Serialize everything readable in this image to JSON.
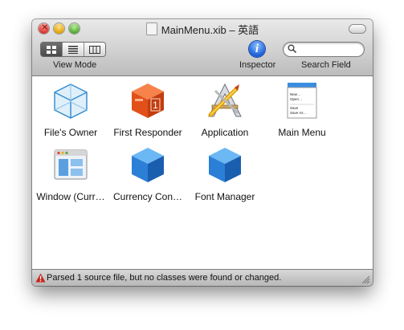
{
  "window": {
    "title": "MainMenu.xib – 英語"
  },
  "toolbar": {
    "view_mode_label": "View Mode",
    "inspector_label": "Inspector",
    "inspector_glyph": "i",
    "search_label": "Search Field",
    "search_value": "",
    "search_placeholder": ""
  },
  "items": [
    {
      "label": "File's Owner",
      "icon": "wireframe-cube-icon"
    },
    {
      "label": "First Responder",
      "icon": "first-responder-cube-icon"
    },
    {
      "label": "Application",
      "icon": "application-icon"
    },
    {
      "label": "Main Menu",
      "icon": "menu-icon"
    },
    {
      "label": "Window (Curr…",
      "icon": "window-icon"
    },
    {
      "label": "Currency Con…",
      "icon": "blue-cube-icon"
    },
    {
      "label": "Font Manager",
      "icon": "blue-cube-icon"
    }
  ],
  "menu_icon_items": [
    "New…",
    "Open…",
    "Save",
    "Save As…"
  ],
  "first_responder_badge": "1",
  "status": {
    "text": "Parsed 1 source file, but no classes were found or changed."
  },
  "colors": {
    "accent_blue": "#1c5fd8",
    "responder_orange": "#e2501a",
    "warning_red": "#c8241b"
  }
}
